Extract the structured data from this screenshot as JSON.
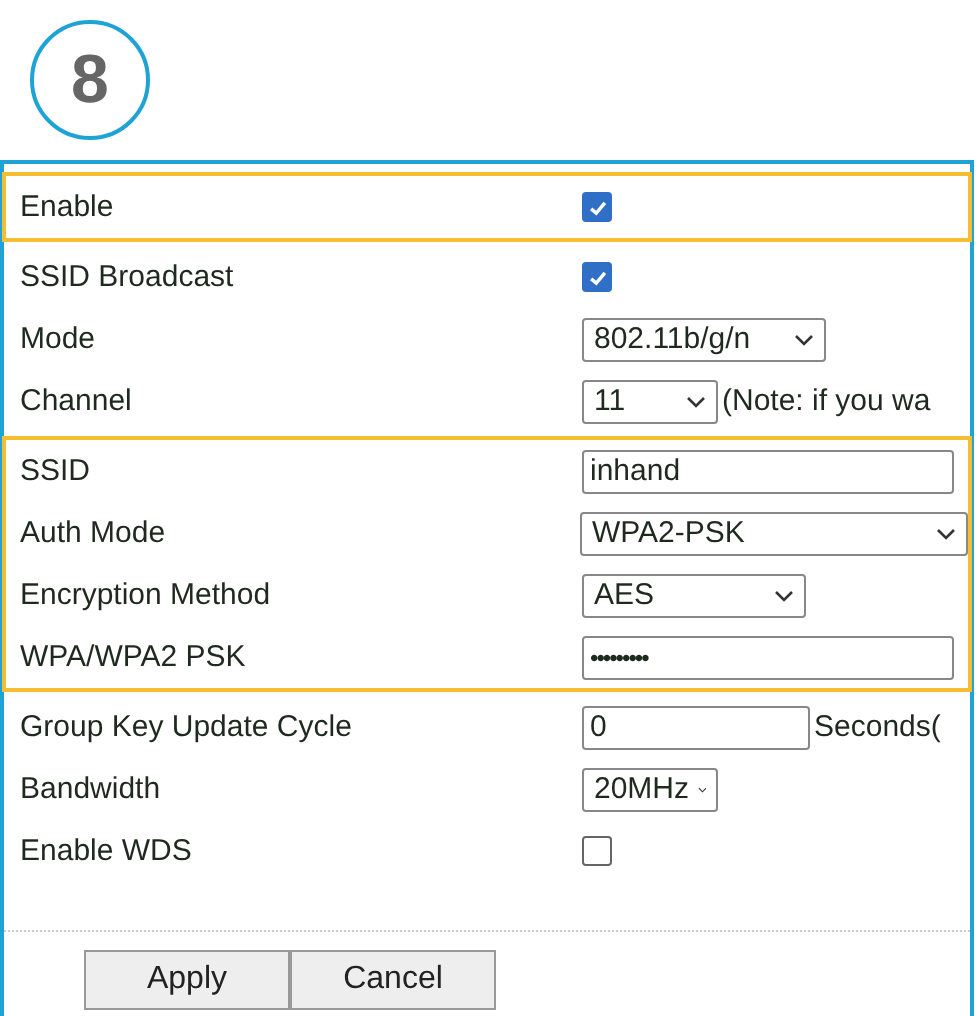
{
  "step_badge": "8",
  "groups": [
    {
      "highlighted": true,
      "rows": [
        {
          "label": "Enable",
          "kind": "checkbox",
          "checked": true
        }
      ]
    },
    {
      "highlighted": false,
      "rows": [
        {
          "label": "SSID Broadcast",
          "kind": "checkbox",
          "checked": true
        },
        {
          "label": "Mode",
          "kind": "select",
          "value": "802.11b/g/n"
        },
        {
          "label": "Channel",
          "kind": "select",
          "value": "11",
          "suffix": "(Note: if you wa"
        }
      ]
    },
    {
      "highlighted": true,
      "rows": [
        {
          "label": "SSID",
          "kind": "text",
          "value": "inhand"
        },
        {
          "label": "Auth Mode",
          "kind": "select",
          "value": "WPA2-PSK"
        },
        {
          "label": "Encryption Method",
          "kind": "select",
          "value": "AES"
        },
        {
          "label": "WPA/WPA2 PSK",
          "kind": "password",
          "value": "•••••••••"
        }
      ]
    },
    {
      "highlighted": false,
      "rows": [
        {
          "label": "Group Key Update Cycle",
          "kind": "text",
          "value": "0",
          "suffix": "Seconds("
        },
        {
          "label": "Bandwidth",
          "kind": "select",
          "value": "20MHz"
        },
        {
          "label": "Enable WDS",
          "kind": "checkbox",
          "checked": false
        }
      ]
    }
  ],
  "buttons": [
    "Apply",
    "Cancel"
  ]
}
